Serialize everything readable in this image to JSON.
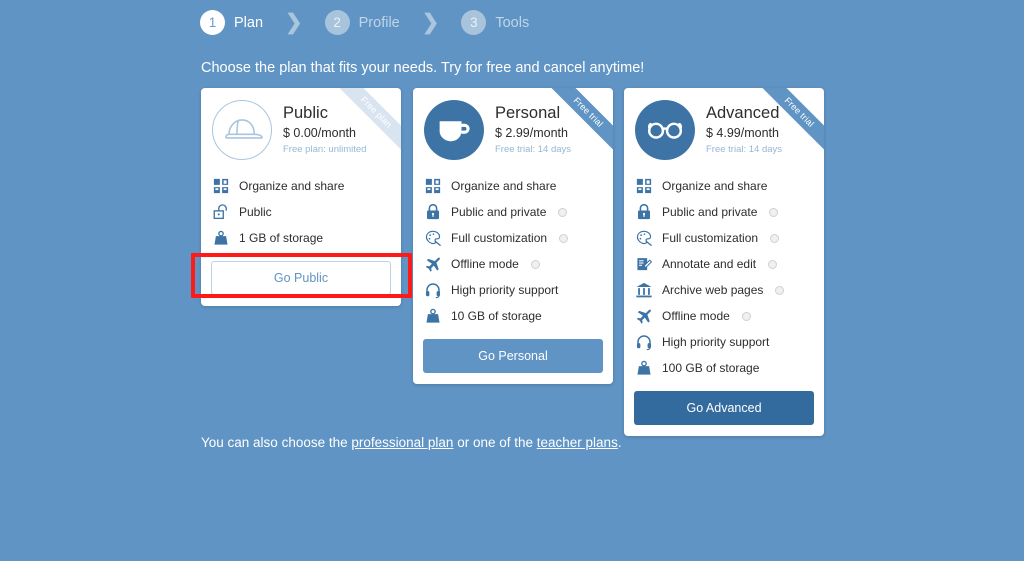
{
  "wizard": {
    "steps": [
      {
        "number": "1",
        "label": "Plan",
        "state": "active"
      },
      {
        "number": "2",
        "label": "Profile",
        "state": "inactive"
      },
      {
        "number": "3",
        "label": "Tools",
        "state": "inactive"
      }
    ],
    "separator": "❯"
  },
  "subtitle": "Choose the plan that fits your needs. Try for free and cancel anytime!",
  "plans": [
    {
      "id": "public",
      "name": "Public",
      "price": "$ 0.00/month",
      "note": "Free plan: unlimited",
      "ribbon": "Free plan",
      "ribbon_style": "free-plan",
      "badge_icon": "cap-icon",
      "badge_style": "outline",
      "cta_label": "Go Public",
      "cta_style": "ghost",
      "features": [
        {
          "icon": "grid-icon",
          "label": "Organize and share",
          "info": false
        },
        {
          "icon": "unlock-icon",
          "label": "Public",
          "info": false
        },
        {
          "icon": "weight-icon",
          "label": "1 GB of storage",
          "info": false
        }
      ]
    },
    {
      "id": "personal",
      "name": "Personal",
      "price": "$ 2.99/month",
      "note": "Free trial: 14 days",
      "ribbon": "Free trial",
      "ribbon_style": "free-trial",
      "badge_icon": "cup-icon",
      "badge_style": "filled",
      "cta_label": "Go Personal",
      "cta_style": "solid",
      "features": [
        {
          "icon": "grid-icon",
          "label": "Organize and share",
          "info": false
        },
        {
          "icon": "lock-icon",
          "label": "Public and private",
          "info": true
        },
        {
          "icon": "palette-icon",
          "label": "Full customization",
          "info": true
        },
        {
          "icon": "airplane-icon",
          "label": "Offline mode",
          "info": true
        },
        {
          "icon": "headset-icon",
          "label": "High priority support",
          "info": false
        },
        {
          "icon": "weight-icon",
          "label": "10 GB of storage",
          "info": false
        }
      ]
    },
    {
      "id": "advanced",
      "name": "Advanced",
      "price": "$ 4.99/month",
      "note": "Free trial: 14 days",
      "ribbon": "Free trial",
      "ribbon_style": "free-trial",
      "badge_icon": "glasses-icon",
      "badge_style": "filled",
      "cta_label": "Go Advanced",
      "cta_style": "solid-dark",
      "features": [
        {
          "icon": "grid-icon",
          "label": "Organize and share",
          "info": false
        },
        {
          "icon": "lock-icon",
          "label": "Public and private",
          "info": true
        },
        {
          "icon": "palette-icon",
          "label": "Full customization",
          "info": true
        },
        {
          "icon": "notepad-icon",
          "label": "Annotate and edit",
          "info": true
        },
        {
          "icon": "bank-icon",
          "label": "Archive web pages",
          "info": true
        },
        {
          "icon": "airplane-icon",
          "label": "Offline mode",
          "info": true
        },
        {
          "icon": "headset-icon",
          "label": "High priority support",
          "info": false
        },
        {
          "icon": "weight-icon",
          "label": "100 GB of storage",
          "info": false
        }
      ]
    }
  ],
  "footer": {
    "prefix": "You can also choose the ",
    "link1": "professional plan",
    "middle": " or one of the ",
    "link2": "teacher plans",
    "suffix": "."
  },
  "annotation": {
    "type": "highlight-box",
    "color": "#ff1a1a",
    "target": "Go Public"
  },
  "colors": {
    "background": "#6094c4",
    "card": "#ffffff",
    "accent": "#6094c4",
    "accent_dark": "#336b9e",
    "badge_fill": "#3d74a5",
    "icon": "#3d74a5",
    "highlight": "#ff1a1a"
  }
}
